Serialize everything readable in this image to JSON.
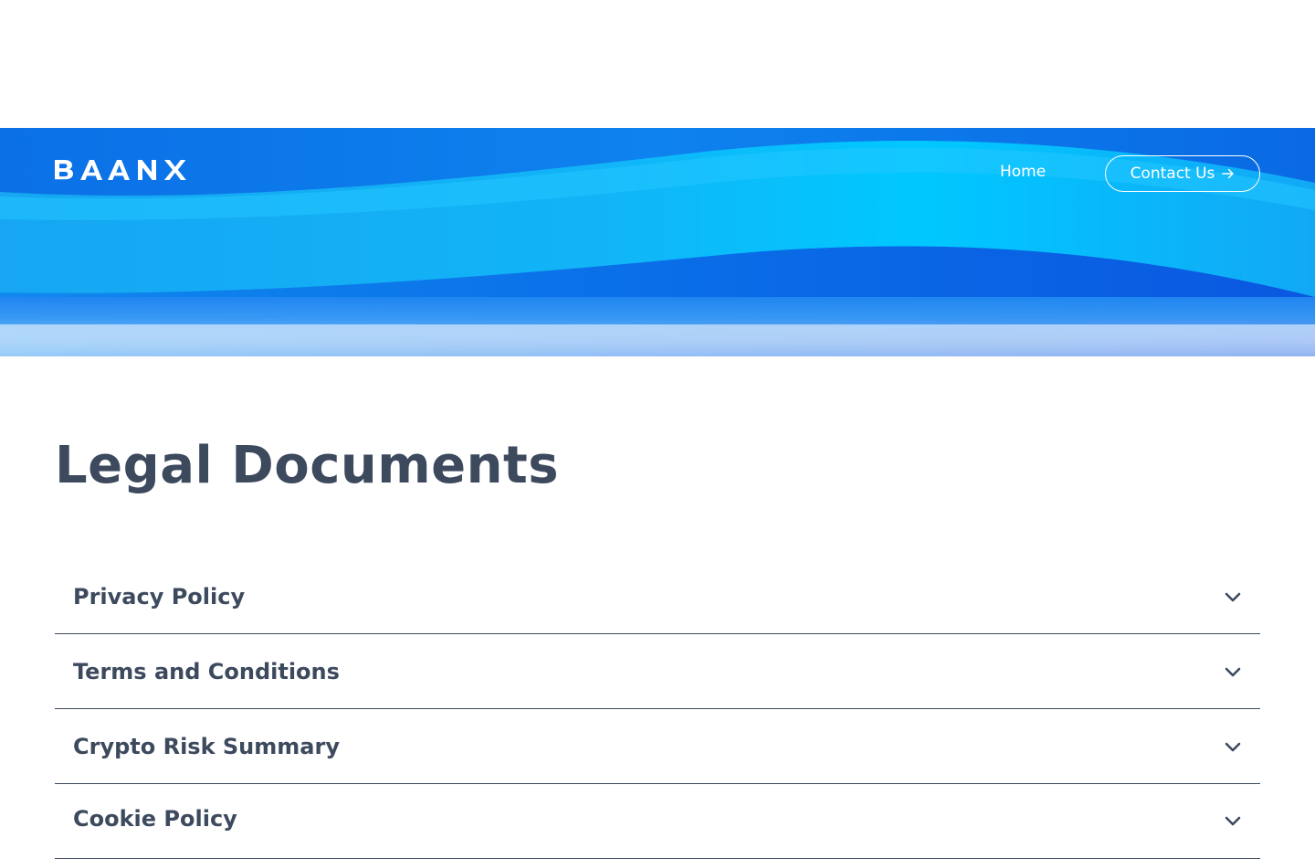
{
  "header": {
    "logo_text": "BAANX",
    "nav": {
      "home_label": "Home",
      "contact_label": "Contact Us"
    }
  },
  "main": {
    "title": "Legal Documents",
    "documents": [
      {
        "label": "Privacy Policy"
      },
      {
        "label": "Terms and Conditions"
      },
      {
        "label": "Crypto Risk Summary"
      },
      {
        "label": "Cookie Policy"
      }
    ]
  },
  "colors": {
    "text_primary": "#3d4a5e",
    "hero_blue_dark": "#0a5ce6",
    "hero_cyan": "#00c4ff",
    "white": "#ffffff"
  },
  "icons": [
    "arrow-right-icon",
    "chevron-down-icon"
  ]
}
